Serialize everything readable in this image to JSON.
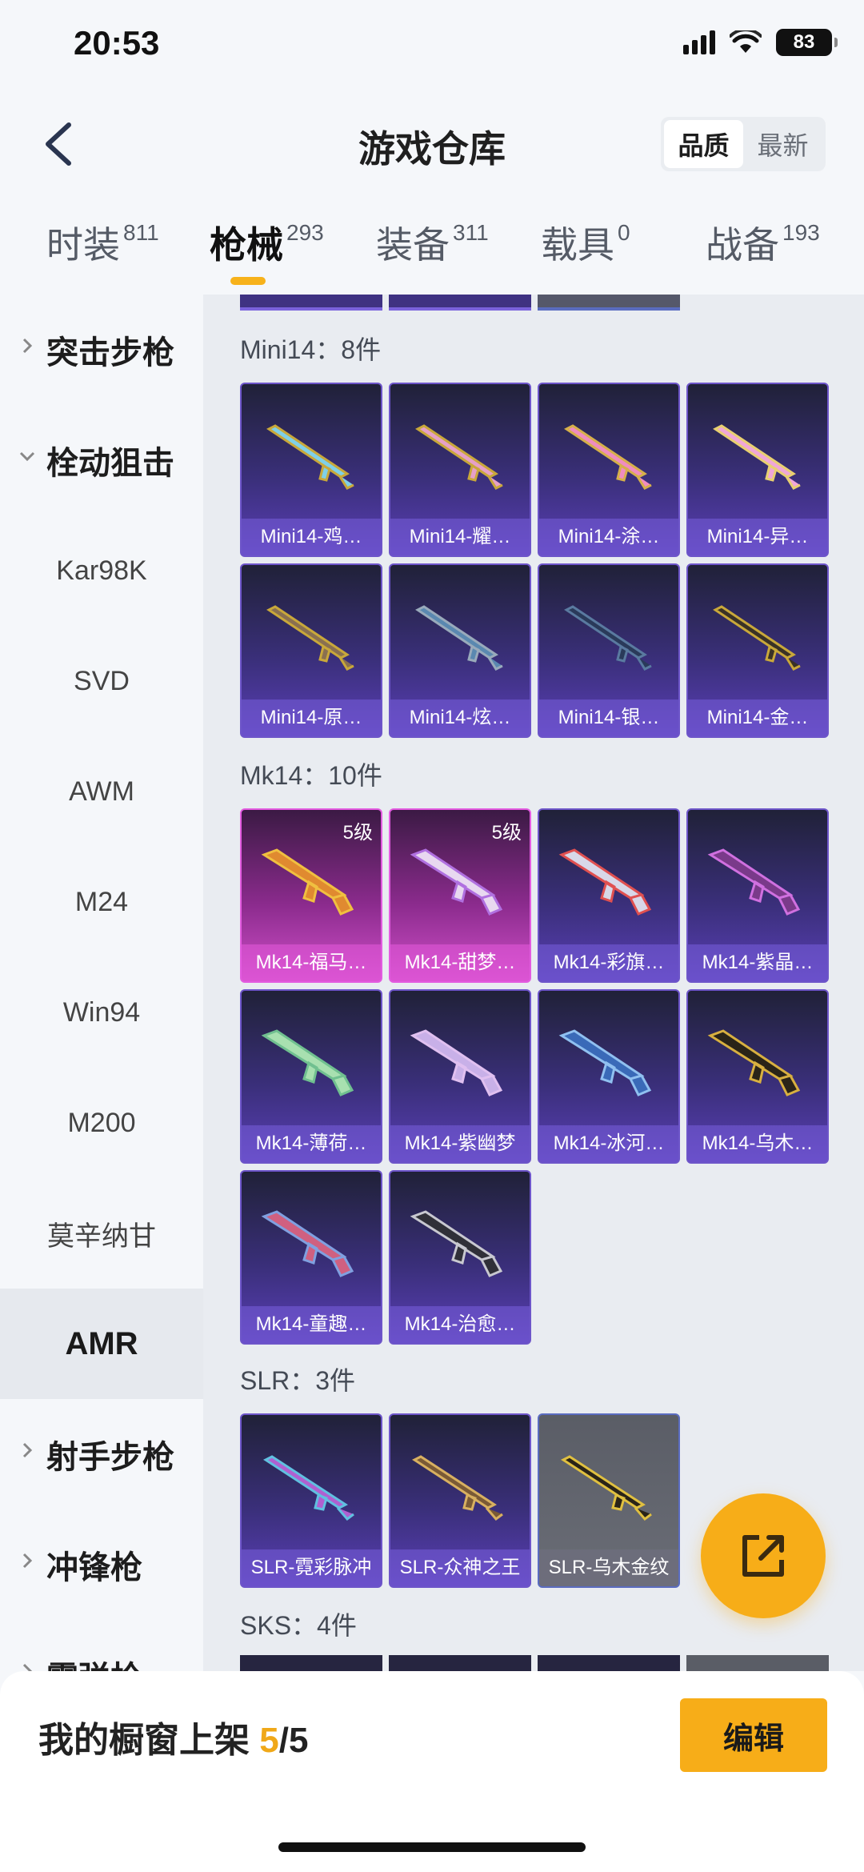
{
  "status": {
    "time": "20:53",
    "battery": "83"
  },
  "header": {
    "title": "游戏仓库",
    "sort_quality": "品质",
    "sort_newest": "最新"
  },
  "tabs": [
    {
      "label": "时装",
      "count": "811"
    },
    {
      "label": "枪械",
      "count": "293"
    },
    {
      "label": "装备",
      "count": "311"
    },
    {
      "label": "载具",
      "count": "0"
    },
    {
      "label": "战备",
      "count": "193"
    }
  ],
  "sidebar": {
    "items": [
      {
        "label": "突击步枪"
      },
      {
        "label": "栓动狙击"
      },
      {
        "label": "Kar98K"
      },
      {
        "label": "SVD"
      },
      {
        "label": "AWM"
      },
      {
        "label": "M24"
      },
      {
        "label": "Win94"
      },
      {
        "label": "M200"
      },
      {
        "label": "莫辛纳甘"
      },
      {
        "label": "AMR"
      },
      {
        "label": "射手步枪"
      },
      {
        "label": "冲锋枪"
      },
      {
        "label": "霰弹枪"
      }
    ]
  },
  "sections": [
    {
      "heading": "Mini14：8件",
      "cards": [
        {
          "label": "Mini14-鸡…"
        },
        {
          "label": "Mini14-耀…"
        },
        {
          "label": "Mini14-涂…"
        },
        {
          "label": "Mini14-异…"
        },
        {
          "label": "Mini14-原…"
        },
        {
          "label": "Mini14-炫…"
        },
        {
          "label": "Mini14-银…"
        },
        {
          "label": "Mini14-金…"
        }
      ]
    },
    {
      "heading": "Mk14：10件",
      "cards": [
        {
          "label": "Mk14-福马…",
          "level": "5级"
        },
        {
          "label": "Mk14-甜梦…",
          "level": "5级"
        },
        {
          "label": "Mk14-彩旗…"
        },
        {
          "label": "Mk14-紫晶…"
        },
        {
          "label": "Mk14-薄荷…"
        },
        {
          "label": "Mk14-紫幽梦"
        },
        {
          "label": "Mk14-冰河…"
        },
        {
          "label": "Mk14-乌木…"
        },
        {
          "label": "Mk14-童趣…"
        },
        {
          "label": "Mk14-治愈…"
        }
      ]
    },
    {
      "heading": "SLR：3件",
      "cards": [
        {
          "label": "SLR-霓彩脉冲"
        },
        {
          "label": "SLR-众神之王"
        },
        {
          "label": "SLR-乌木金纹"
        }
      ]
    },
    {
      "heading": "SKS：4件"
    }
  ],
  "bottom": {
    "shelf_label": "我的橱窗上架 ",
    "shelf_count": "5",
    "shelf_total": "/5",
    "edit_label": "编辑"
  },
  "colors": {
    "accent": "#f7ad18",
    "card_purple": "#3a2f7a",
    "card_pink": "#d04fc9"
  }
}
